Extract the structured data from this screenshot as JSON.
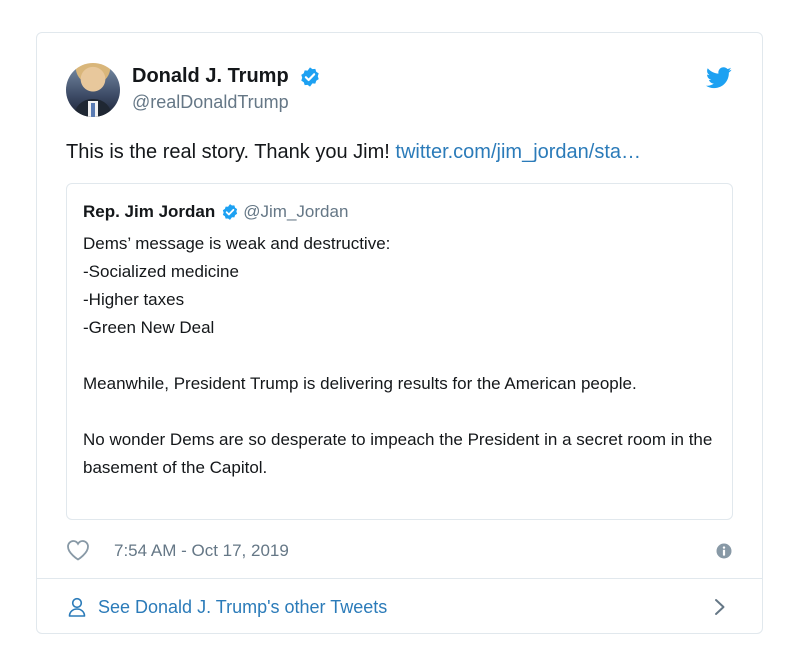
{
  "tweet": {
    "author_name": "Donald J. Trump",
    "author_handle": "@realDonaldTrump",
    "text": "This is the real story. Thank you Jim!",
    "link": "twitter.com/jim_jordan/sta…",
    "timestamp": "7:54 AM - Oct 17, 2019",
    "icons": [
      "avatar",
      "verified-badge-icon",
      "twitter-bird-icon",
      "heart-icon",
      "info-icon"
    ]
  },
  "quoted": {
    "author_name": "Rep. Jim Jordan",
    "author_handle": "@Jim_Jordan",
    "lines": [
      "Dems’ message is weak and destructive:",
      "-Socialized medicine",
      "-Higher taxes",
      "-Green New Deal"
    ],
    "paragraph_2": "Meanwhile, President Trump is delivering results for the American people.",
    "paragraph_3": "No wonder Dems are so desperate to impeach the President in a secret room in the basement of the Capitol."
  },
  "footer": {
    "link_label": "See Donald J. Trump's other Tweets",
    "icons": [
      "person-icon",
      "chevron-right-icon"
    ]
  },
  "colors": {
    "link": "#2b7bb9",
    "verified": "#1da1f2",
    "border": "#e1e8ed",
    "muted": "#657786",
    "text": "#14171a"
  }
}
